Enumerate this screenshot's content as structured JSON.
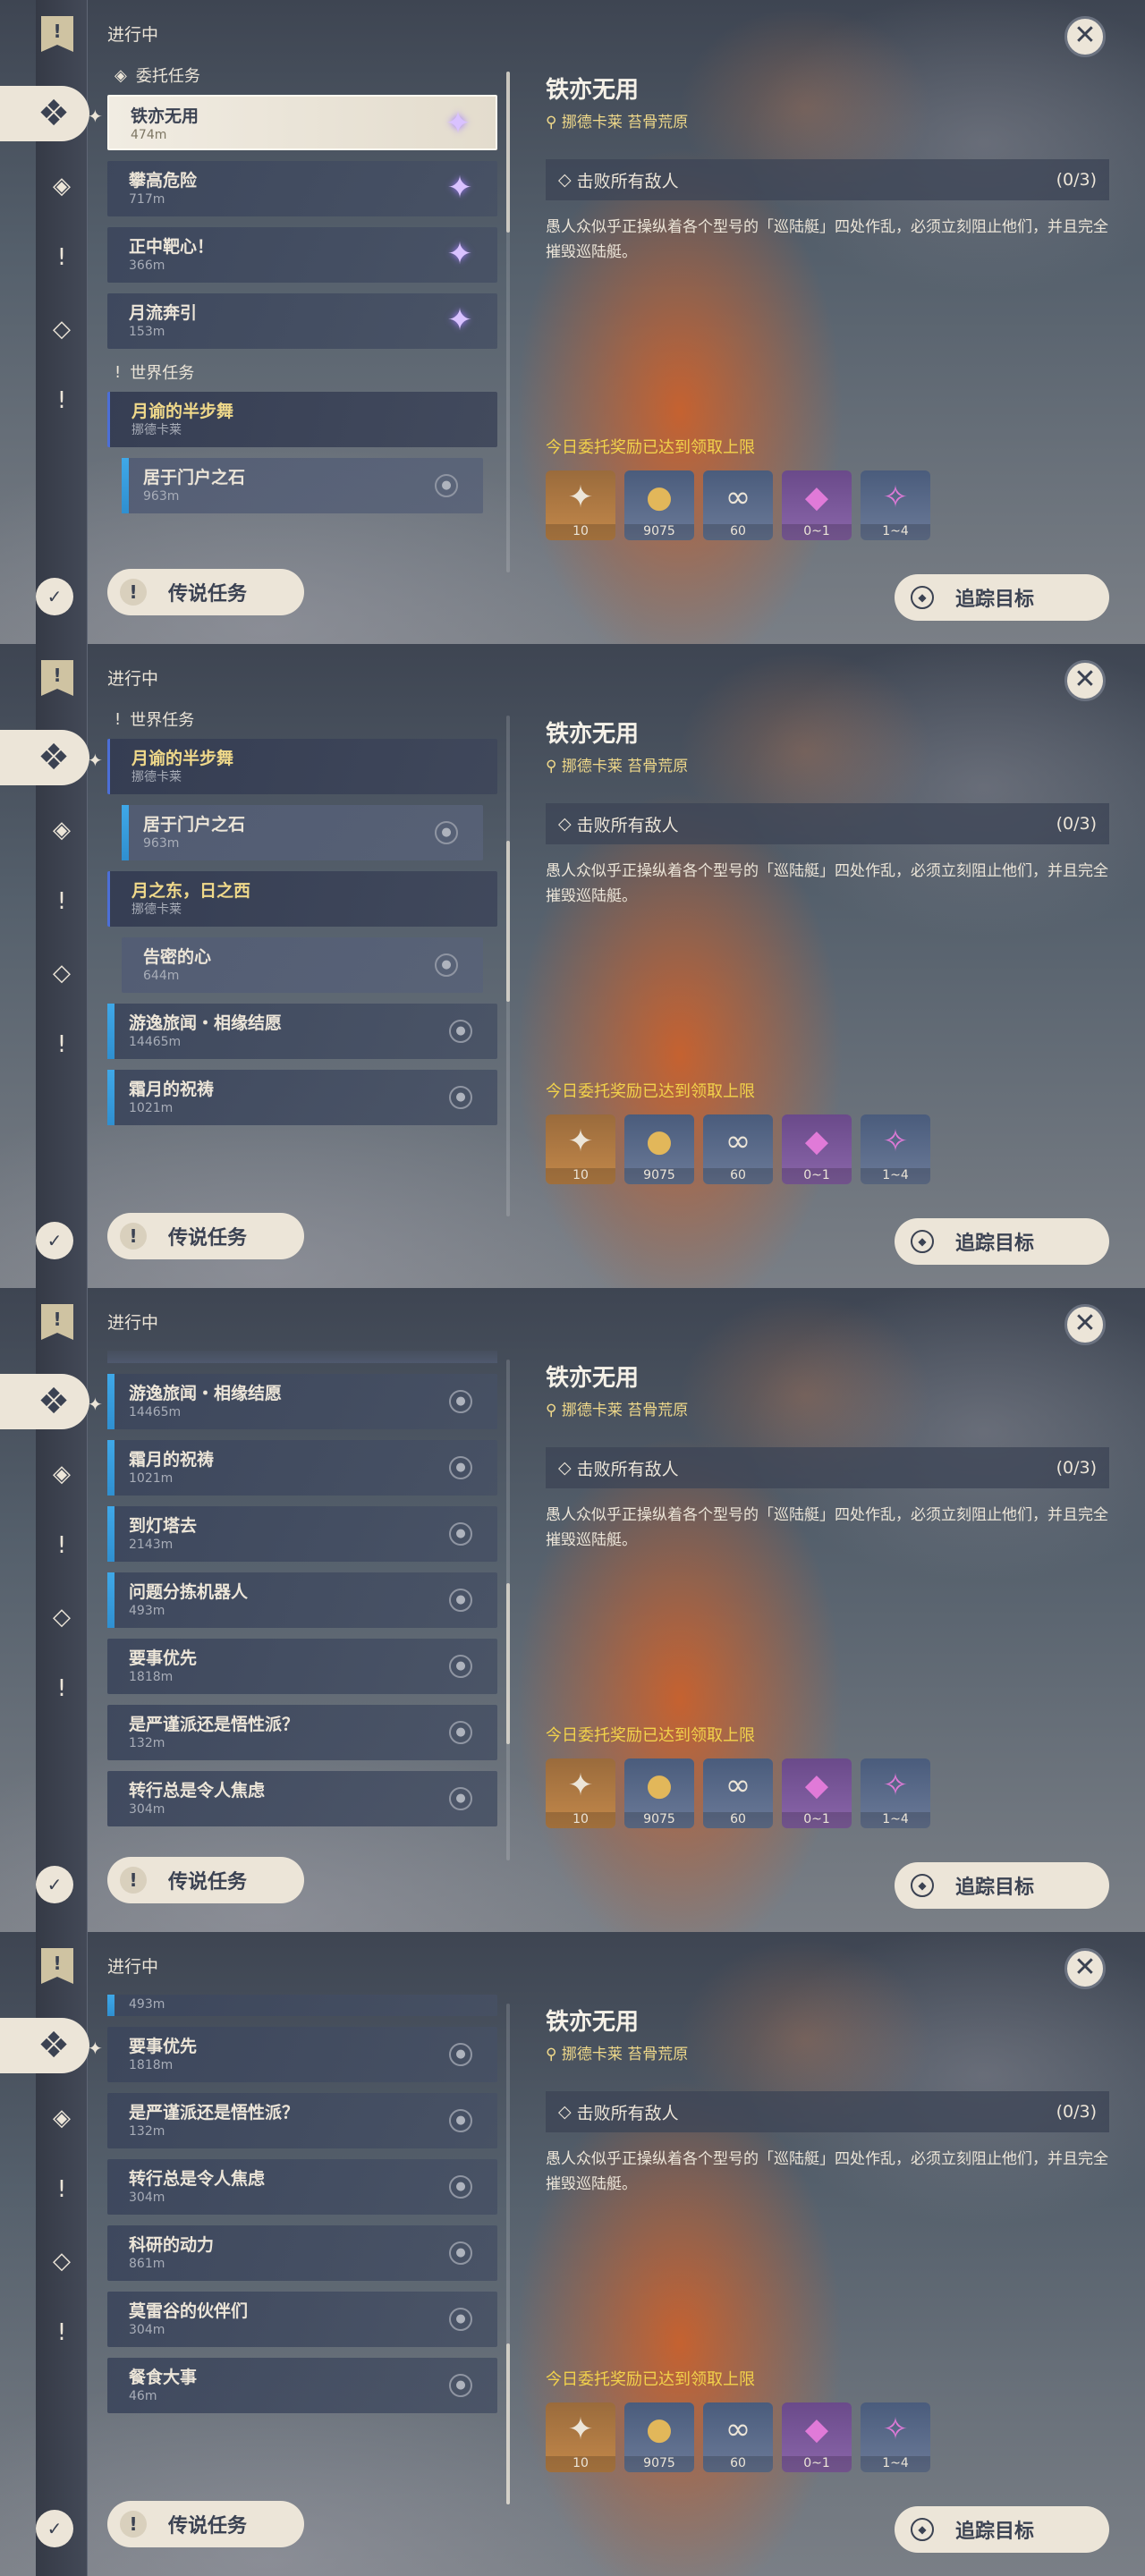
{
  "header": {
    "status": "进行中"
  },
  "sections": {
    "commission": "委托任务",
    "world": "世界任务"
  },
  "buttons": {
    "legend": "传说任务",
    "track": "追踪目标"
  },
  "detail": {
    "title": "铁亦无用",
    "location": "挪德卡莱 苔骨荒原",
    "objective": "击败所有敌人",
    "objective_count": "(0/3)",
    "description": "愚人众似乎正操纵着各个型号的「巡陆艇」四处作乱，必须立刻阻止他们，并且完全摧毁巡陆艇。",
    "limit_notice": "今日委托奖励已达到领取上限",
    "rewards": [
      {
        "icon": "adventure-exp-icon",
        "count": "10",
        "color": "#c3884a"
      },
      {
        "icon": "mora-icon",
        "count": "9075",
        "color": "#4a5c7c"
      },
      {
        "icon": "companionship-icon",
        "count": "60",
        "color": "#4a5c7c"
      },
      {
        "icon": "crystal-icon",
        "count": "0~1",
        "color": "#6a4a8a"
      },
      {
        "icon": "crystal-shard-icon",
        "count": "1~4",
        "color": "#4a5c7c"
      }
    ]
  },
  "quests": {
    "tieyi": {
      "title": "铁亦无用",
      "dist": "474m"
    },
    "pangao": {
      "title": "攀高危险",
      "dist": "717m"
    },
    "zhengzhong": {
      "title": "正中靶心！",
      "dist": "366m"
    },
    "yueliu": {
      "title": "月流奔引",
      "dist": "153m"
    },
    "yueyu": {
      "title": "月谕的半步舞",
      "dist": "挪德卡莱"
    },
    "juyu": {
      "title": "居于门户之石",
      "dist": "963m"
    },
    "yuezhidong": {
      "title": "月之东，日之西",
      "dist": "挪德卡莱"
    },
    "gaomi": {
      "title": "告密的心",
      "dist": "644m"
    },
    "youyi": {
      "title": "游逸旅闻・相缘结愿",
      "dist": "14465m"
    },
    "shuangyue": {
      "title": "霜月的祝祷",
      "dist": "1021m"
    },
    "daodengta": {
      "title": "到灯塔去",
      "dist": "2143m"
    },
    "wenti": {
      "title": "问题分拣机器人",
      "dist": "493m"
    },
    "yaoshi": {
      "title": "要事优先",
      "dist": "1818m"
    },
    "yanjin": {
      "title": "是严谨派还是悟性派？",
      "dist": "132m"
    },
    "zhuanxing": {
      "title": "转行总是令人焦虑",
      "dist": "304m"
    },
    "keyan": {
      "title": "科研的动力",
      "dist": "861m"
    },
    "moleigu": {
      "title": "莫雷谷的伙伴们",
      "dist": "304m"
    },
    "canshi": {
      "title": "餐食大事",
      "dist": "46m"
    }
  }
}
